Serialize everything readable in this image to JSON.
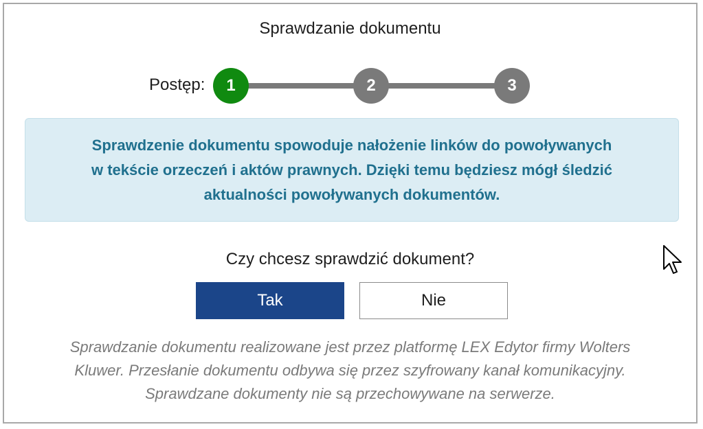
{
  "dialog": {
    "title": "Sprawdzanie dokumentu",
    "progress": {
      "label": "Postęp:",
      "steps": [
        "1",
        "2",
        "3"
      ],
      "active_step": 1
    },
    "info_lines": [
      "Sprawdzenie dokumentu spowoduje nałożenie linków do powoływanych",
      "w tekście orzeczeń i aktów prawnych. Dzięki temu będziesz mógł śledzić",
      "aktualności powoływanych dokumentów."
    ],
    "question": "Czy chcesz sprawdzić dokument?",
    "buttons": {
      "yes": "Tak",
      "no": "Nie"
    },
    "footnote_lines": [
      "Sprawdzanie dokumentu realizowane jest przez platformę LEX Edytor firmy Wolters",
      "Kluwer. Przesłanie dokumentu odbywa się przez szyfrowany kanał komunikacyjny.",
      "Sprawdzane dokumenty nie są przechowywane na serwerze."
    ]
  },
  "colors": {
    "step_active": "#108a10",
    "step_inactive": "#7a7a7a",
    "info_background": "#dcedf4",
    "info_text": "#20708e",
    "primary_button": "#1b4589"
  },
  "icons": {
    "cursor": "mouse-pointer-icon"
  }
}
